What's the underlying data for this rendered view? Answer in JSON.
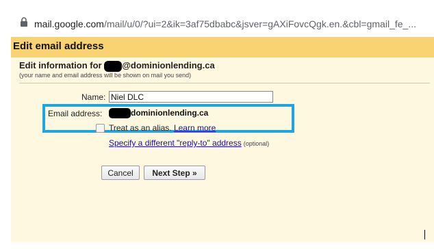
{
  "browser": {
    "url_host": "mail.google.com",
    "url_path": "/mail/u/0/?ui=2&ik=3af75dbabc&jsver=gAXiFovcQgk.en.&cbl=gmail_fe_..."
  },
  "dialog": {
    "title": "Edit email address",
    "section_title_prefix": "Edit information for ",
    "section_title_suffix": "@dominionlending.ca",
    "section_subtitle": "(your name and email address will be shown on mail you send)"
  },
  "form": {
    "name_label": "Name:",
    "name_value": "Niel DLC",
    "email_label": "Email address:",
    "email_suffix": "dominionlending.ca",
    "alias_label": "Treat as an alias.",
    "learn_more": "Learn more",
    "reply_to_link": "Specify a different \"reply-to\" address",
    "reply_to_optional": "(optional)",
    "alias_checked": false
  },
  "buttons": {
    "cancel": "Cancel",
    "next": "Next Step »"
  },
  "colors": {
    "titlebar": "#f9d371",
    "dialog_bg": "#fff8e1",
    "highlight": "#1ca7e0",
    "link": "#1a0dab"
  }
}
